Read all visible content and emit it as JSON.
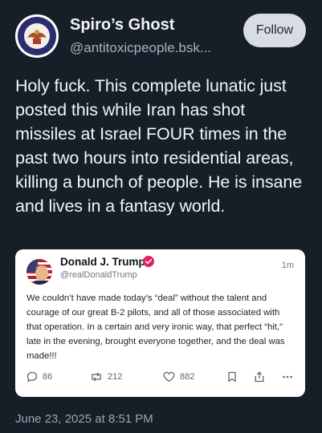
{
  "author": {
    "name": "Spiro’s Ghost",
    "handle": "@antitoxicpeople.bsk..."
  },
  "follow_button": {
    "label": "Follow"
  },
  "post": {
    "text": "Holy fuck. This complete lunatic just posted this while Iran has shot missiles at Israel FOUR times in the past two hours into residential areas, killing a bunch of people. He is insane and lives in a fantasy world.",
    "timestamp": "June 23, 2025 at 8:51 PM"
  },
  "quoted_post": {
    "name": "Donald J. Trump",
    "handle": "@realDonaldTrump",
    "time": "1m",
    "text": "We couldn’t have made today’s “deal” without the talent and courage of our great B-2 pilots, and all of those associated with that operation. In a certain and very ironic way, that perfect “hit,” late in the evening, brought everyone together, and the deal was made!!!",
    "replies": "86",
    "reposts": "212",
    "likes": "882"
  },
  "colors": {
    "background": "#161e27",
    "follow_bg": "#d8dde3",
    "verified_badge": "#e0245e"
  }
}
